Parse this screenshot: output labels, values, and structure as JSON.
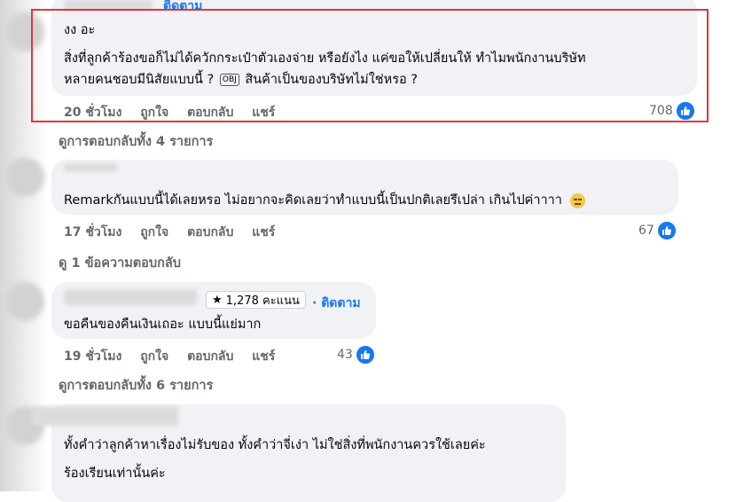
{
  "comments": [
    {
      "follow_label": "ติดตาม",
      "line1": "งง อะ",
      "line2": "สิ่งที่ลูกค้าร้องขอก็ไม่ได้ควักกระเป๋าตัวเองจ่าย หรือยังไง แค่ขอให้เปลี่ยนให้ ทำไมพนักงานบริษัท",
      "line3a": "หลายคนชอบมีนิสัยแบบนี้ ?",
      "line3_sticker": "OBJ",
      "line3b": "สินค้าเป็นของบริษัทไม่ใช่หรอ ?",
      "time": "20 ชั่วโมง",
      "like": "ถูกใจ",
      "reply": "ตอบกลับ",
      "share": "แชร์",
      "reactions": "708",
      "view_replies": "ดูการตอบกลับทั้ง 4 รายการ"
    },
    {
      "text": "Remarkกันแบบนี้ได้เลยหรอ ไม่อยากจะคิดเลยว่าทำแบบนี้เป็นปกติเลยรึเปล่า เกินไปค่าาาา",
      "time": "17 ชั่วโมง",
      "like": "ถูกใจ",
      "reply": "ตอบกลับ",
      "share": "แชร์",
      "reactions": "67",
      "view_replies": "ดู 1 ข้อความตอบกลับ"
    },
    {
      "badge": "1,278 คะแนน",
      "follow_label": "ติดตาม",
      "text": "ขอคืนของคืนเงินเถอะ แบบนี้แย่มาก",
      "time": "19 ชั่วโมง",
      "like": "ถูกใจ",
      "reply": "ตอบกลับ",
      "share": "แชร์",
      "reactions": "43",
      "view_replies": "ดูการตอบกลับทั้ง 6 รายการ"
    },
    {
      "line1": "ทั้งคำว่าลูกค้าหาเรื่องไม่รับของ ทั้งคำว่าจี่เง่า ไม่ใช่สิ่งที่พนักงานควรใช้เลยค่ะ",
      "line2": "ร้องเรียนเท่านั้นค่ะ"
    }
  ],
  "colors": {
    "highlight_border": "#e0363b",
    "link_blue": "#1877f2",
    "bubble_bg": "#f0f2f5",
    "meta_gray": "#65676b"
  }
}
